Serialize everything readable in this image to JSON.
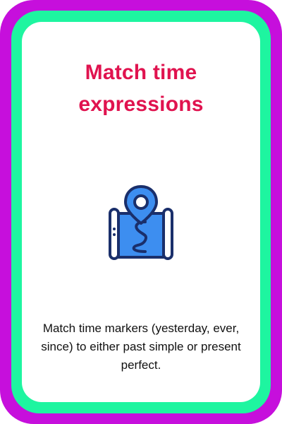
{
  "card": {
    "title_line1": "Match time",
    "title_line2": "expressions",
    "icon": "map-pin-route-icon",
    "description": "Match time markers (yesterday, ever, since) to either past simple or present perfect."
  },
  "colors": {
    "outer_border": "#c60fdc",
    "inner_border": "#1ef5a0",
    "title": "#e0134f",
    "icon_fill": "#3d8ef0",
    "icon_stroke": "#1a2f6b"
  }
}
